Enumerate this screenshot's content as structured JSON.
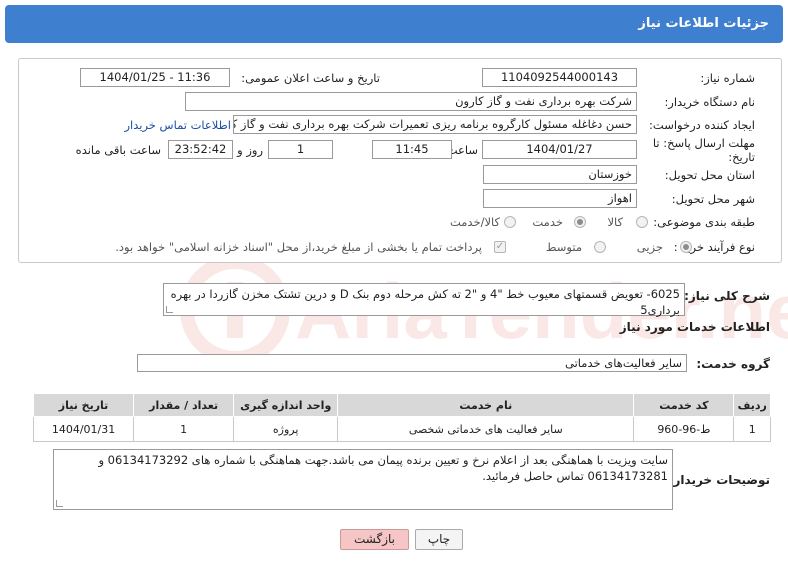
{
  "header": {
    "title": "جزئیات اطلاعات نیاز"
  },
  "form": {
    "need_number_label": "شماره نیاز:",
    "need_number": "1104092544000143",
    "announce_label": "تاریخ و ساعت اعلان عمومی:",
    "announce_value": "1404/01/25 - 11:36",
    "buyer_org_label": "نام دستگاه خریدار:",
    "buyer_org": "شرکت بهره برداری نفت و گاز کارون",
    "requester_label": "ایجاد کننده درخواست:",
    "requester": "حسن دغاغله مسئول کارگروه برنامه ریزی تعمیرات شرکت بهره برداری نفت و گاز کارون",
    "contact_link": "اطلاعات تماس خریدار",
    "deadline_label_1": "مهلت ارسال پاسخ: تا",
    "deadline_label_2": "تاریخ:",
    "deadline_date": "1404/01/27",
    "time_label": "ساعت",
    "deadline_time": "11:45",
    "days_value": "1",
    "days_label": "روز و",
    "remaining_time": "23:52:42",
    "remaining_label": "ساعت باقی مانده",
    "province_label": "استان محل تحویل:",
    "province": "خوزستان",
    "city_label": "شهر محل تحویل:",
    "city": "اهواز",
    "category_label": "طبقه بندی موضوعی:",
    "category_options": [
      "کالا",
      "خدمت",
      "کالا/خدمت"
    ],
    "category_selected": "خدمت",
    "process_label": "نوع فرآیند خرید :",
    "process_options": [
      "جزیی",
      "متوسط"
    ],
    "payment_note": "پرداخت تمام یا بخشی از مبلغ خرید،از محل \"اسناد خزانه اسلامی\" خواهد بود."
  },
  "summary": {
    "label": "شرح کلی نیاز:",
    "text": "6025- تعویض قسمتهای معیوب خط \"4 و \"2 ته کش مرحله دوم بنک D و درین تشتک مخزن گازردا در بهره برداری5"
  },
  "services": {
    "section_title": "اطلاعات خدمات مورد نیاز",
    "group_label": "گروه خدمت:",
    "group_value": "سایر فعالیت‌های خدماتی"
  },
  "table": {
    "headers": [
      "ردیف",
      "کد خدمت",
      "نام خدمت",
      "واحد اندازه گیری",
      "تعداد / مقدار",
      "تاریخ نیاز"
    ],
    "rows": [
      [
        "1",
        "ط-96-960",
        "سایر فعالیت های خدماتی شخصی",
        "پروژه",
        "1",
        "1404/01/31"
      ]
    ]
  },
  "buyer_notes": {
    "label": "توضیحات خریدار:",
    "text": "سایت ویزیت با هماهنگی بعد از اعلام نرخ و تعیین برنده پیمان می باشد.جهت هماهنگی با شماره های  06134173292 و 06134173281 تماس حاصل فرمائید."
  },
  "buttons": {
    "print": "چاپ",
    "back": "بازگشت"
  },
  "watermark": {
    "text": "AriaTender.neT"
  },
  "colors": {
    "header": "#3f7fd0",
    "back_button": "#f6c6c6",
    "watermark": "#d84a3a"
  }
}
